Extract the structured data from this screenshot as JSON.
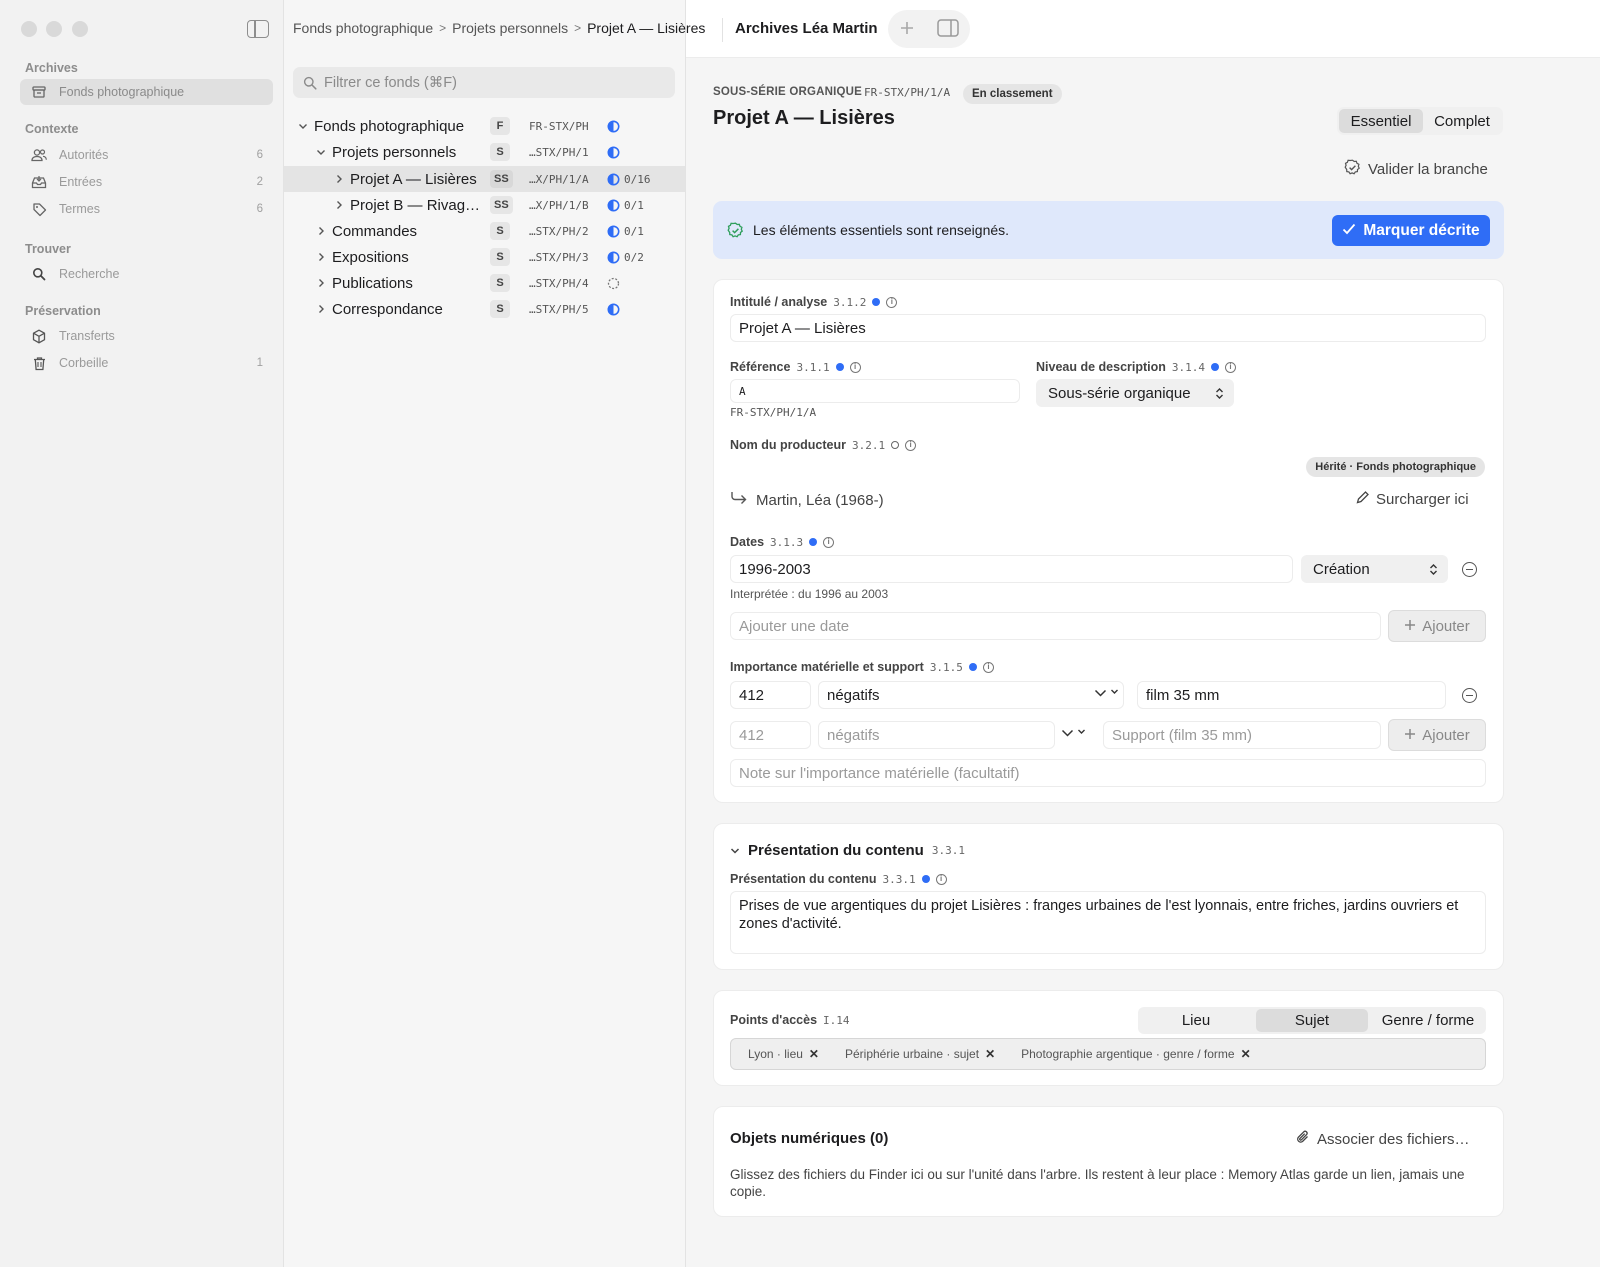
{
  "sidebar": {
    "sections": [
      {
        "title": "Archives",
        "items": [
          {
            "label": "Fonds photographique",
            "count": ""
          }
        ]
      },
      {
        "title": "Contexte",
        "items": [
          {
            "label": "Autorités",
            "count": "6"
          },
          {
            "label": "Entrées",
            "count": "2"
          },
          {
            "label": "Termes",
            "count": "6"
          }
        ]
      },
      {
        "title": "Trouver",
        "items": [
          {
            "label": "Recherche",
            "count": ""
          }
        ]
      },
      {
        "title": "Préservation",
        "items": [
          {
            "label": "Transferts",
            "count": ""
          },
          {
            "label": "Corbeille",
            "count": "1"
          }
        ]
      }
    ]
  },
  "breadcrumb": {
    "items": [
      "Fonds photographique",
      "Projets personnels",
      "Projet A — Lisières"
    ],
    "separator": ">"
  },
  "window": {
    "title": "Archives Léa Martin"
  },
  "filter": {
    "placeholder": "Filtrer ce fonds (⌘F)"
  },
  "tree": [
    {
      "label": "Fonds photographique",
      "badge": "F",
      "code": "FR-STX/PH",
      "progress": ""
    },
    {
      "label": "Projets personnels",
      "badge": "S",
      "code": "…STX/PH/1",
      "progress": ""
    },
    {
      "label": "Projet A — Lisières",
      "badge": "SS",
      "code": "…X/PH/1/A",
      "progress": "0/16"
    },
    {
      "label": "Projet B — Rivag…",
      "badge": "SS",
      "code": "…X/PH/1/B",
      "progress": "0/1"
    },
    {
      "label": "Commandes",
      "badge": "S",
      "code": "…STX/PH/2",
      "progress": "0/1"
    },
    {
      "label": "Expositions",
      "badge": "S",
      "code": "…STX/PH/3",
      "progress": "0/2"
    },
    {
      "label": "Publications",
      "badge": "S",
      "code": "…STX/PH/4",
      "progress": ""
    },
    {
      "label": "Correspondance",
      "badge": "S",
      "code": "…STX/PH/5",
      "progress": ""
    }
  ],
  "record": {
    "level_caption": "SOUS-SÉRIE ORGANIQUE",
    "ref_code": "FR-STX/PH/1/A",
    "status": "En classement",
    "title": "Projet A — Lisières",
    "view_modes": [
      "Essentiel",
      "Complet"
    ],
    "validate_label": "Valider la branche"
  },
  "banner": {
    "text": "Les éléments essentiels sont renseignés.",
    "button": "Marquer décrite",
    "color": "#2f6df6"
  },
  "fields": {
    "intitule": {
      "label": "Intitulé / analyse",
      "num": "3.1.2",
      "value": "Projet A — Lisières"
    },
    "reference": {
      "label": "Référence",
      "num": "3.1.1",
      "value": "A",
      "full": "FR-STX/PH/1/A"
    },
    "niveau": {
      "label": "Niveau de description",
      "num": "3.1.4",
      "value": "Sous-série organique"
    },
    "producteur": {
      "label": "Nom du producteur",
      "num": "3.2.1",
      "inherited": "Hérité · Fonds photographique",
      "value": "Martin, Léa (1968-)",
      "override": "Surcharger ici"
    },
    "dates": {
      "label": "Dates",
      "num": "3.1.3",
      "value": "1996-2003",
      "type": "Création",
      "interpreted": "Interprétée : du 1996 au 2003",
      "add_placeholder": "Ajouter une date",
      "add_button": "Ajouter"
    },
    "importance": {
      "label": "Importance matérielle et support",
      "num": "3.1.5",
      "rows": [
        {
          "qty": "412",
          "unit": "négatifs",
          "support": "film 35 mm"
        }
      ],
      "new_row": {
        "qty": "412",
        "unit": "négatifs",
        "support": "Support (film 35 mm)"
      },
      "add_button": "Ajouter",
      "note_placeholder": "Note sur l'importance matérielle (facultatif)"
    }
  },
  "presentation": {
    "section_title": "Présentation du contenu",
    "section_num": "3.3.1",
    "label": "Présentation du contenu",
    "num": "3.3.1",
    "value": "Prises de vue argentiques du projet Lisières : franges urbaines de l'est lyonnais, entre friches, jardins ouvriers et zones d'activité."
  },
  "access_points": {
    "label": "Points d'accès",
    "num": "I.14",
    "tabs": [
      "Lieu",
      "Sujet",
      "Genre / forme"
    ],
    "active_tab": "Sujet",
    "tags": [
      "Lyon · lieu",
      "Périphérie urbaine · sujet",
      "Photographie argentique · genre / forme"
    ]
  },
  "digital": {
    "title": "Objets numériques (0)",
    "action": "Associer des fichiers…",
    "text": "Glissez des fichiers du Finder ici ou sur l'unité dans l'arbre. Ils restent à leur place : Memory Atlas garde un lien, jamais une copie."
  }
}
